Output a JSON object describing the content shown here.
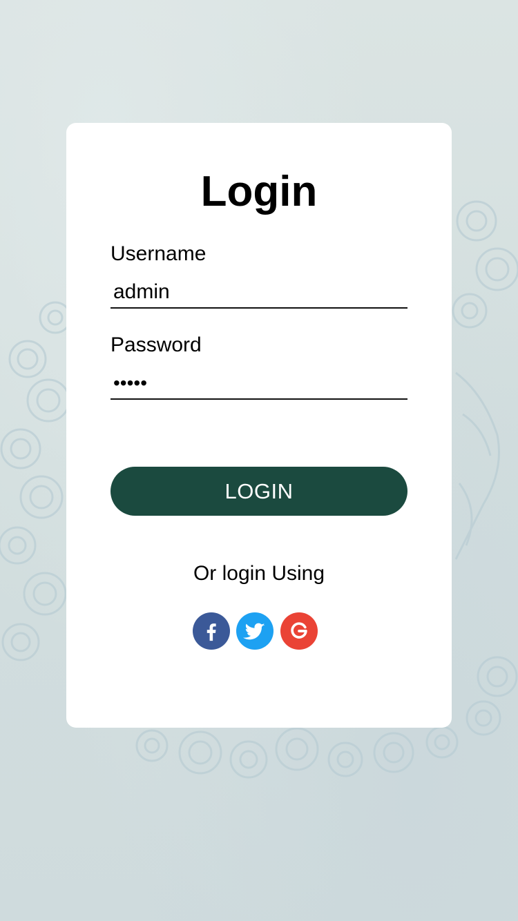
{
  "page": {
    "background_color": "#d3dfdf",
    "card_color": "#ffffff",
    "accent_color": "#1b4a3f"
  },
  "login": {
    "title": "Login",
    "username_label": "Username",
    "username_value": "admin",
    "password_label": "Password",
    "password_value": "•••••",
    "submit_label": "LOGIN",
    "alt_text": "Or login Using"
  },
  "social": [
    {
      "name": "facebook-icon",
      "color": "#3b5998"
    },
    {
      "name": "twitter-icon",
      "color": "#1da1f2"
    },
    {
      "name": "google-icon",
      "color": "#ea4335"
    }
  ]
}
